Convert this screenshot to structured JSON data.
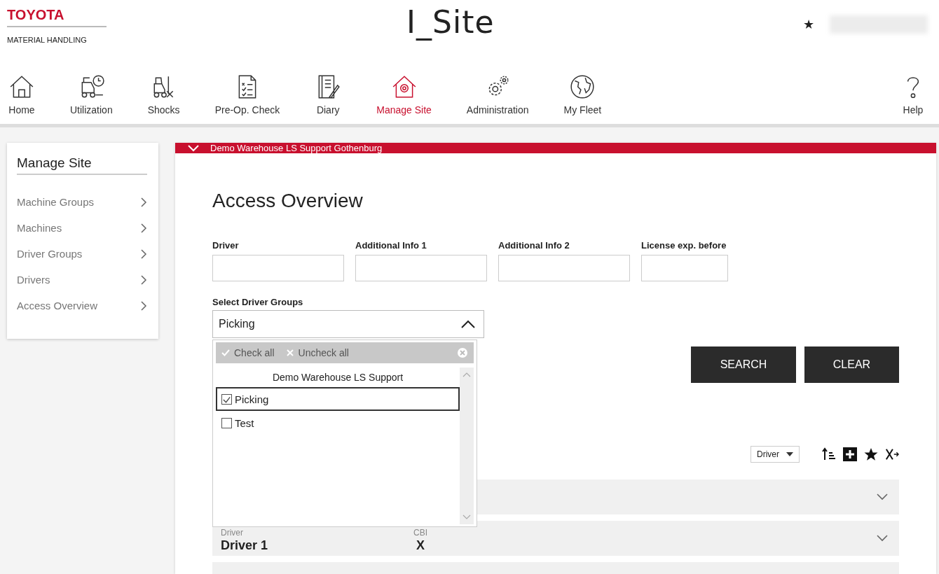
{
  "header": {
    "brand": "TOYOTA",
    "brand_sub": "MATERIAL HANDLING",
    "app_title": "I_Site",
    "favorite": "★"
  },
  "nav": [
    {
      "label": "Home",
      "selected": false
    },
    {
      "label": "Utilization",
      "selected": false
    },
    {
      "label": "Shocks",
      "selected": false
    },
    {
      "label": "Pre-Op. Check",
      "selected": false
    },
    {
      "label": "Diary",
      "selected": false
    },
    {
      "label": "Manage Site",
      "selected": true
    },
    {
      "label": "Administration",
      "selected": false
    },
    {
      "label": "My Fleet",
      "selected": false
    },
    {
      "label": "Help",
      "selected": false
    }
  ],
  "sidebar": {
    "title": "Manage Site",
    "items": [
      {
        "label": "Machine Groups"
      },
      {
        "label": "Machines"
      },
      {
        "label": "Driver Groups"
      },
      {
        "label": "Drivers"
      },
      {
        "label": "Access Overview"
      }
    ]
  },
  "site_bar": {
    "label": "Demo Warehouse LS Support Gothenburg",
    "expanded": true
  },
  "page_title": "Access Overview",
  "filters": [
    {
      "label": "Driver"
    },
    {
      "label": "Additional Info 1"
    },
    {
      "label": "Additional Info 2"
    },
    {
      "label": "License exp. before"
    }
  ],
  "driver_groups": {
    "label": "Select Driver Groups",
    "value": "Picking",
    "open": true,
    "check_all": "Check all",
    "uncheck_all": "Uncheck all",
    "group": "Demo Warehouse LS Support",
    "options": [
      {
        "label": "Picking",
        "checked": true,
        "selected": true
      },
      {
        "label": "Test",
        "checked": false,
        "selected": false
      }
    ]
  },
  "buttons": [
    "SEARCH",
    "CLEAR"
  ],
  "sort_select": "Driver",
  "rows": [
    {
      "expanded": false
    },
    {
      "expanded": false,
      "fields": [
        {
          "label": "Driver",
          "value": "Driver 1"
        },
        {
          "label": "CBI",
          "value": "X"
        }
      ]
    },
    {}
  ]
}
